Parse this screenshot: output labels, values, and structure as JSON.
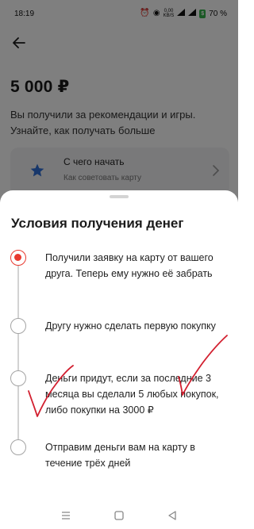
{
  "status_bar": {
    "time": "18:19",
    "net_speed": "0,00",
    "net_unit": "KB/S",
    "battery_percent": "70 %"
  },
  "screen": {
    "amount": "5 000 ₽",
    "description": "Вы получили за рекомендации и игры. Узнайте, как получать больше",
    "card": {
      "title": "С чего начать",
      "subtitle": "Как советовать карту"
    }
  },
  "sheet": {
    "title": "Условия получения денег",
    "steps": [
      {
        "text": "Получили заявку на карту от вашего друга. Теперь ему нужно её забрать",
        "active": true
      },
      {
        "text": "Другу нужно сделать первую покупку",
        "active": false
      },
      {
        "text": "Деньги придут, если за последние 3 месяца вы сделали 5 любых покупок, либо покупки на 3000 ₽",
        "active": false
      },
      {
        "text": "Отправим деньги вам на карту в течение трёх дней",
        "active": false
      }
    ]
  },
  "colors": {
    "accent": "#e8392f",
    "star": "#2f6fd6",
    "scribble": "#d21f2f",
    "battery": "#35b34a"
  },
  "icons": {
    "back": "arrow-left-icon",
    "card": "star-icon",
    "card_chevron": "chevron-right-icon",
    "nav": [
      "menu-icon",
      "home-square-icon",
      "back-triangle-icon"
    ]
  }
}
